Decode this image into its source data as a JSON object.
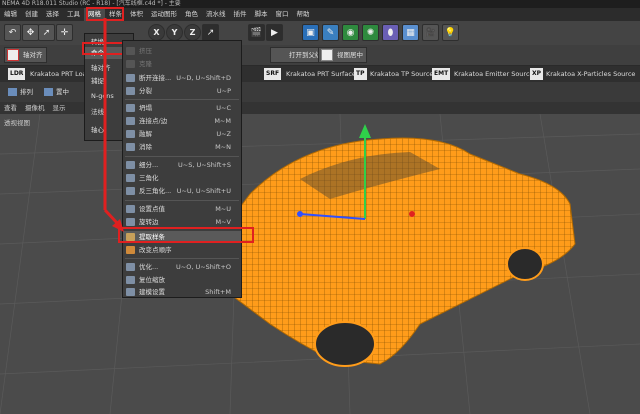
{
  "window": {
    "title": "NEMA 4D R18.011 Studio (RC - R18) - [汽车线框.c4d *] - 主要"
  },
  "menubar": [
    "编辑",
    "创建",
    "选择",
    "工具",
    "网格",
    "样条",
    "体积",
    "运动图形",
    "角色",
    "流水线",
    "插件",
    "脚本",
    "窗口",
    "帮助"
  ],
  "menubar_active": "网格",
  "mesh_menu": [
    "转换",
    "命令",
    "轴对齐",
    "捕捉",
    "N-gons",
    "法线",
    "轴心"
  ],
  "command_submenu": {
    "items": [
      {
        "label": "挤压",
        "shortcut": "",
        "disabled": true
      },
      {
        "label": "克隆",
        "shortcut": "",
        "disabled": true
      },
      {
        "label": "断开连接...",
        "shortcut": "U~D, U~Shift+D"
      },
      {
        "label": "分裂",
        "shortcut": "U~P"
      },
      {
        "label": "坍塌",
        "shortcut": "U~C"
      },
      {
        "label": "连接点/边",
        "shortcut": "M~M"
      },
      {
        "label": "融解",
        "shortcut": "U~Z"
      },
      {
        "label": "消除",
        "shortcut": "M~N"
      },
      {
        "label": "细分...",
        "shortcut": "U~S, U~Shift+S"
      },
      {
        "label": "三角化",
        "shortcut": ""
      },
      {
        "label": "反三角化...",
        "shortcut": "U~U, U~Shift+U"
      },
      {
        "label": "设置点值",
        "shortcut": "M~U"
      },
      {
        "label": "旋转边",
        "shortcut": "M~V"
      },
      {
        "label": "提取样条",
        "shortcut": "",
        "highlighted": true
      },
      {
        "label": "改变点顺序",
        "shortcut": ""
      },
      {
        "label": "优化...",
        "shortcut": "U~O, U~Shift+O"
      },
      {
        "label": "复位缩放",
        "shortcut": ""
      },
      {
        "label": "建模设置",
        "shortcut": "Shift+M"
      }
    ]
  },
  "toolbar2": {
    "align_label": "轴对齐",
    "model_label": "打开到父级",
    "view_label": "视图居中"
  },
  "pluginbar": [
    {
      "badge": "LDR",
      "label": "Krakatoa PRT Loader"
    },
    {
      "badge": "",
      "label": "olume"
    },
    {
      "badge": "SRF",
      "label": "Krakatoa PRT Surface"
    },
    {
      "badge": "TP",
      "label": "Krakatoa TP Source"
    },
    {
      "badge": "EMT",
      "label": "Krakatoa Emitter Source"
    },
    {
      "badge": "XP",
      "label": "Krakatoa X-Particles Source"
    }
  ],
  "toolbar3": {
    "items": [
      "排列",
      "置中"
    ]
  },
  "viewmenu": [
    "查看",
    "摄像机",
    "显示"
  ],
  "viewport": {
    "label": "透视视图"
  },
  "colors": {
    "wire": "#ff9c1a",
    "accent_red": "#e02020"
  }
}
